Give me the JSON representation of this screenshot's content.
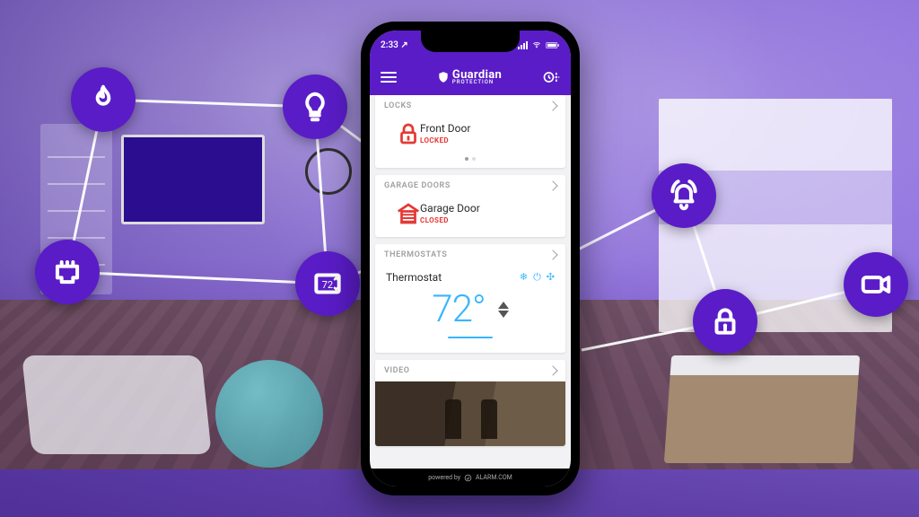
{
  "statusbar": {
    "time": "2:33",
    "time_indicator": "↗"
  },
  "header": {
    "brand_main": "Guardian",
    "brand_sub": "PROTECTION"
  },
  "cards": {
    "locks": {
      "title": "LOCKS",
      "item": "Front Door",
      "status": "LOCKED"
    },
    "garage": {
      "title": "GARAGE DOORS",
      "item": "Garage Door",
      "status": "CLOSED"
    },
    "therm": {
      "title": "THERMOSTATS",
      "item": "Thermostat",
      "temp": "72°"
    },
    "video": {
      "title": "VIDEO"
    }
  },
  "footer": {
    "powered": "powered by",
    "provider": "ALARM.COM"
  },
  "graph_nodes": {
    "fire": "fire-icon",
    "bulb": "lightbulb-icon",
    "plug": "ethernet-icon",
    "thermo": "thermostat-icon",
    "bell": "bell-icon",
    "lock": "lock-icon",
    "cam": "camera-icon"
  }
}
